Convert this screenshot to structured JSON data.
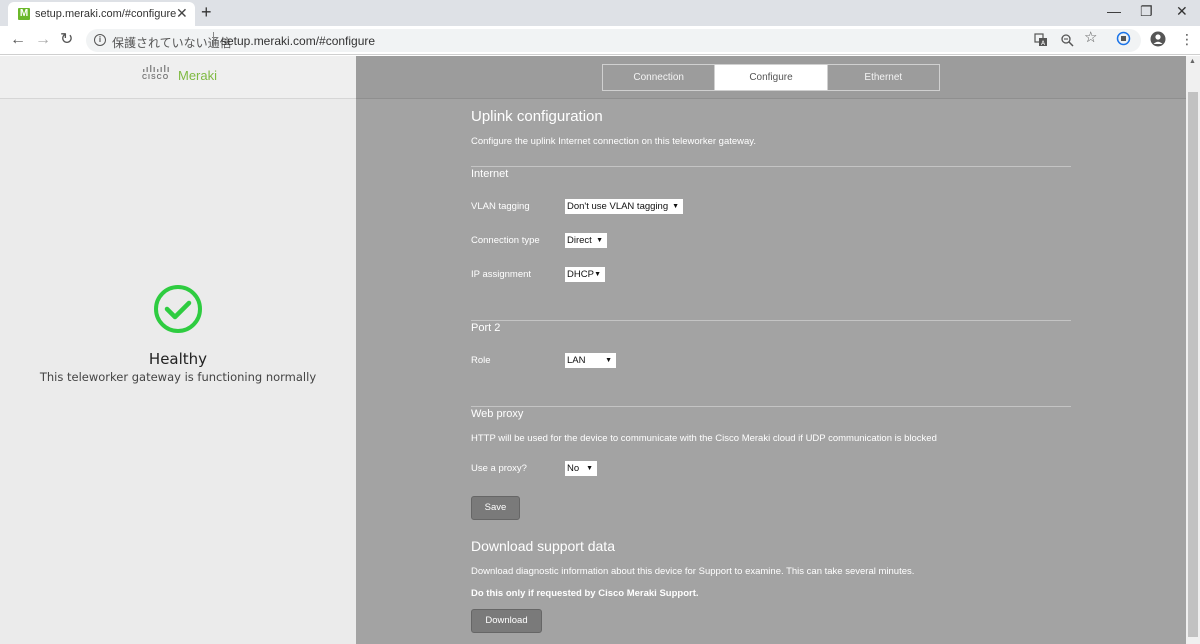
{
  "browser": {
    "tab": {
      "favicon": "M",
      "title": "setup.meraki.com/#configure",
      "close": "✕"
    },
    "new_tab": "+",
    "window_controls": {
      "minimize": "—",
      "restore": "❐",
      "close": "✕"
    },
    "nav": {
      "back": "←",
      "forward": "→",
      "reload": "↻"
    },
    "omnibox": {
      "security_text": "保護されていない通信",
      "url": "setup.meraki.com/#configure"
    },
    "icons": [
      "translate-icon",
      "zoom-icon",
      "star-icon",
      "extension-icon",
      "profile-icon",
      "menu-icon"
    ]
  },
  "brand": {
    "cisco": "CISCO",
    "meraki": "Meraki",
    "accent_color": "#7fba42"
  },
  "status": {
    "title": "Healthy",
    "description": "This teleworker gateway is functioning normally",
    "color": "#2ecc40"
  },
  "nav_tabs": [
    {
      "label": "Connection",
      "active": false
    },
    {
      "label": "Configure",
      "active": true
    },
    {
      "label": "Ethernet",
      "active": false
    }
  ],
  "uplink": {
    "title": "Uplink configuration",
    "description": "Configure the uplink Internet connection on this teleworker gateway.",
    "internet": {
      "heading": "Internet",
      "vlan_label": "VLAN tagging",
      "vlan_value": "Don't use VLAN tagging",
      "conn_label": "Connection type",
      "conn_value": "Direct",
      "ip_label": "IP assignment",
      "ip_value": "DHCP"
    },
    "port2": {
      "heading": "Port 2",
      "role_label": "Role",
      "role_value": "LAN"
    },
    "proxy": {
      "heading": "Web proxy",
      "description": "HTTP will be used for the device to communicate with the Cisco Meraki cloud if UDP communication is blocked",
      "use_label": "Use a proxy?",
      "use_value": "No"
    },
    "save_label": "Save"
  },
  "support": {
    "title": "Download support data",
    "description": "Download diagnostic information about this device for Support to examine. This can take several minutes.",
    "note": "Do this only if requested by Cisco Meraki Support.",
    "download_label": "Download"
  }
}
